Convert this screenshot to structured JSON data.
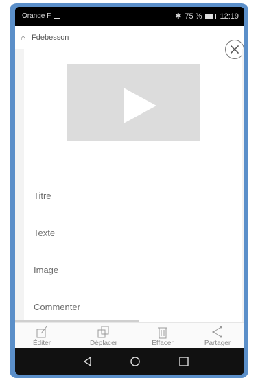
{
  "statusbar": {
    "carrier": "Orange F",
    "battery": "75 %",
    "time": "12:19"
  },
  "user": {
    "name": "Fdebesson",
    "icon": "lock-icon"
  },
  "close_icon": "close-icon",
  "video": {
    "icon": "play-icon"
  },
  "menu": {
    "items": [
      {
        "label": "Titre"
      },
      {
        "label": "Texte"
      },
      {
        "label": "Image"
      },
      {
        "label": "Commenter"
      }
    ]
  },
  "toolbar": {
    "items": [
      {
        "label": "Éditer",
        "icon": "edit-icon"
      },
      {
        "label": "Déplacer",
        "icon": "move-icon"
      },
      {
        "label": "Effacer",
        "icon": "trash-icon"
      },
      {
        "label": "Partager",
        "icon": "share-icon"
      }
    ]
  },
  "navbar": {
    "items": [
      {
        "icon": "back-icon"
      },
      {
        "icon": "home-icon"
      },
      {
        "icon": "recents-icon"
      }
    ]
  },
  "colors": {
    "frame": "#5b8fc9",
    "video_placeholder": "#dcdcdc"
  }
}
